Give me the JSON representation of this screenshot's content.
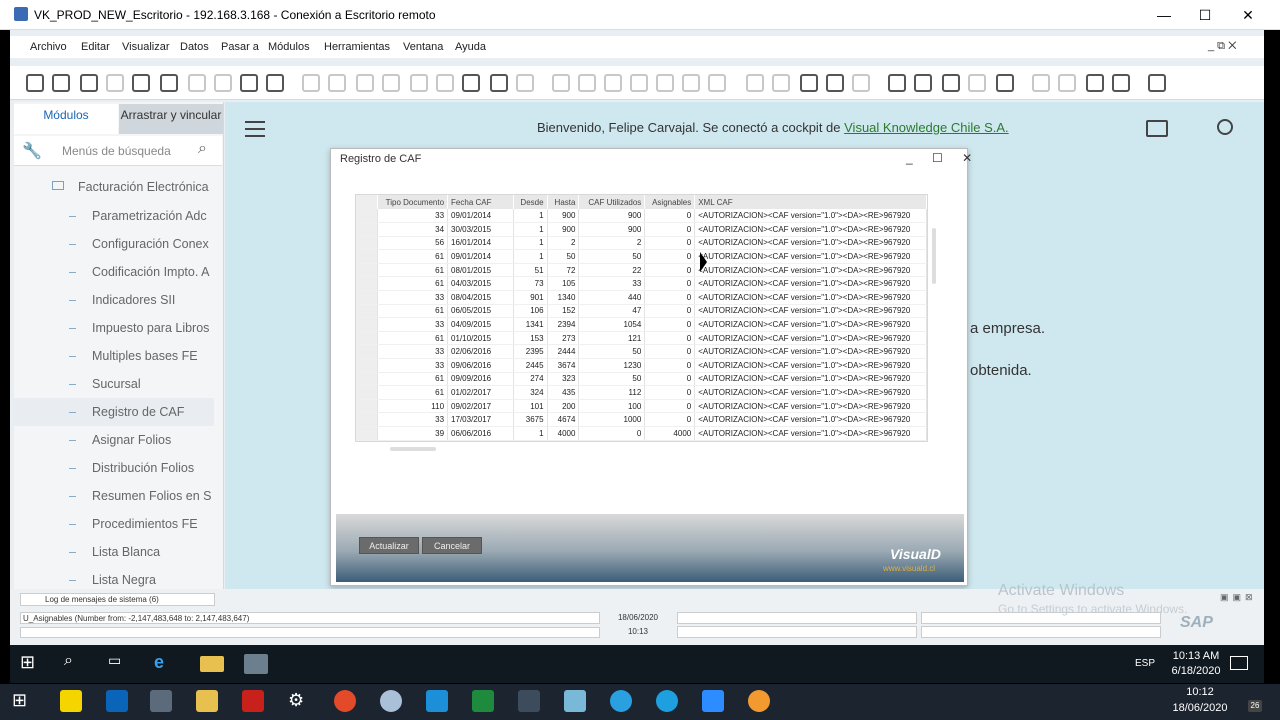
{
  "window": {
    "title": "VK_PROD_NEW_Escritorio - 192.168.3.168 - Conexión a Escritorio remoto"
  },
  "window_buttons": {
    "minimize": "—",
    "maximize": "☐",
    "close": "✕"
  },
  "menubar": {
    "items": [
      "Archivo",
      "Editar",
      "Visualizar",
      "Datos",
      "Pasar a",
      "Módulos",
      "Herramientas",
      "Ventana",
      "Ayuda"
    ],
    "controls": "_ ⧉ ✕"
  },
  "sidebar": {
    "tab_modules": "Módulos",
    "tab_drag": "Arrastrar y vincular",
    "search_placeholder": "Menús de búsqueda",
    "folder": "Facturación Electrónica",
    "items": [
      "Parametrización Adc",
      "Configuración Conex",
      "Codificación Impto. A",
      "Indicadores SII",
      "Impuesto para Libros",
      "Multiples bases FE",
      "Sucursal",
      "Registro de CAF",
      "Asignar Folios",
      "Distribución Folios",
      "Resumen Folios en S",
      "Procedimientos FE",
      "Lista Blanca",
      "Lista Negra"
    ],
    "selected_index": 7
  },
  "cockpit": {
    "welcome_prefix": "Bienvenido, Felipe Carvajal. Se conectó a cockpit de ",
    "welcome_link": "Visual Knowledge Chile S.A.",
    "text2": "a empresa.",
    "text3": "obtenida."
  },
  "dialog": {
    "title": "Registro de CAF",
    "controls": "_ ☐ ✕",
    "columns": [
      "Tipo Documento",
      "Fecha CAF",
      "Desde",
      "Hasta",
      "CAF Utilizados",
      "Asignables",
      "XML CAF"
    ],
    "rows": [
      [
        "33",
        "09/01/2014",
        "1",
        "900",
        "900",
        "0",
        "<AUTORIZACION><CAF version=\"1.0\"><DA><RE>967920"
      ],
      [
        "34",
        "30/03/2015",
        "1",
        "900",
        "900",
        "0",
        "<AUTORIZACION><CAF version=\"1.0\"><DA><RE>967920"
      ],
      [
        "56",
        "16/01/2014",
        "1",
        "2",
        "2",
        "0",
        "<AUTORIZACION><CAF version=\"1.0\"><DA><RE>967920"
      ],
      [
        "61",
        "09/01/2014",
        "1",
        "50",
        "50",
        "0",
        "<AUTORIZACION><CAF version=\"1.0\"><DA><RE>967920"
      ],
      [
        "61",
        "08/01/2015",
        "51",
        "72",
        "22",
        "0",
        "<AUTORIZACION><CAF version=\"1.0\"><DA><RE>967920"
      ],
      [
        "61",
        "04/03/2015",
        "73",
        "105",
        "33",
        "0",
        "<AUTORIZACION><CAF version=\"1.0\"><DA><RE>967920"
      ],
      [
        "33",
        "08/04/2015",
        "901",
        "1340",
        "440",
        "0",
        "<AUTORIZACION><CAF version=\"1.0\"><DA><RE>967920"
      ],
      [
        "61",
        "06/05/2015",
        "106",
        "152",
        "47",
        "0",
        "<AUTORIZACION><CAF version=\"1.0\"><DA><RE>967920"
      ],
      [
        "33",
        "04/09/2015",
        "1341",
        "2394",
        "1054",
        "0",
        "<AUTORIZACION><CAF version=\"1.0\"><DA><RE>967920"
      ],
      [
        "61",
        "01/10/2015",
        "153",
        "273",
        "121",
        "0",
        "<AUTORIZACION><CAF version=\"1.0\"><DA><RE>967920"
      ],
      [
        "33",
        "02/06/2016",
        "2395",
        "2444",
        "50",
        "0",
        "<AUTORIZACION><CAF version=\"1.0\"><DA><RE>967920"
      ],
      [
        "33",
        "09/06/2016",
        "2445",
        "3674",
        "1230",
        "0",
        "<AUTORIZACION><CAF version=\"1.0\"><DA><RE>967920"
      ],
      [
        "61",
        "09/09/2016",
        "274",
        "323",
        "50",
        "0",
        "<AUTORIZACION><CAF version=\"1.0\"><DA><RE>967920"
      ],
      [
        "61",
        "01/02/2017",
        "324",
        "435",
        "112",
        "0",
        "<AUTORIZACION><CAF version=\"1.0\"><DA><RE>967920"
      ],
      [
        "110",
        "09/02/2017",
        "101",
        "200",
        "100",
        "0",
        "<AUTORIZACION><CAF version=\"1.0\"><DA><RE>967920"
      ],
      [
        "33",
        "17/03/2017",
        "3675",
        "4674",
        "1000",
        "0",
        "<AUTORIZACION><CAF version=\"1.0\"><DA><RE>967920"
      ],
      [
        "39",
        "06/06/2016",
        "1",
        "4000",
        "0",
        "4000",
        "<AUTORIZACION><CAF version=\"1.0\"><DA><RE>967920"
      ]
    ],
    "btn_update": "Actualizar",
    "btn_cancel": "Cancelar",
    "logo": "VisualD",
    "logo_url": "www.visuald.cl"
  },
  "status": {
    "log_tab": "Log de mensajes de sistema (6)",
    "message": "U_Asignables (Number from: -2,147,483,648 to: 2,147,483,647)",
    "date": "18/06/2020",
    "time": "10:13",
    "activate_title": "Activate Windows",
    "activate_sub": "Go to Settings to activate Windows.",
    "sap_logo": "SAP"
  },
  "remote_taskbar": {
    "time": "10:13 AM",
    "date": "6/18/2020",
    "lang": "ESP"
  },
  "local_taskbar": {
    "time": "10:12",
    "date": "18/06/2020",
    "badge": "26"
  },
  "colors": {
    "cockpit_bg": "#cfe8ef",
    "link": "#2c7a2c",
    "accent": "#1a66b3"
  }
}
